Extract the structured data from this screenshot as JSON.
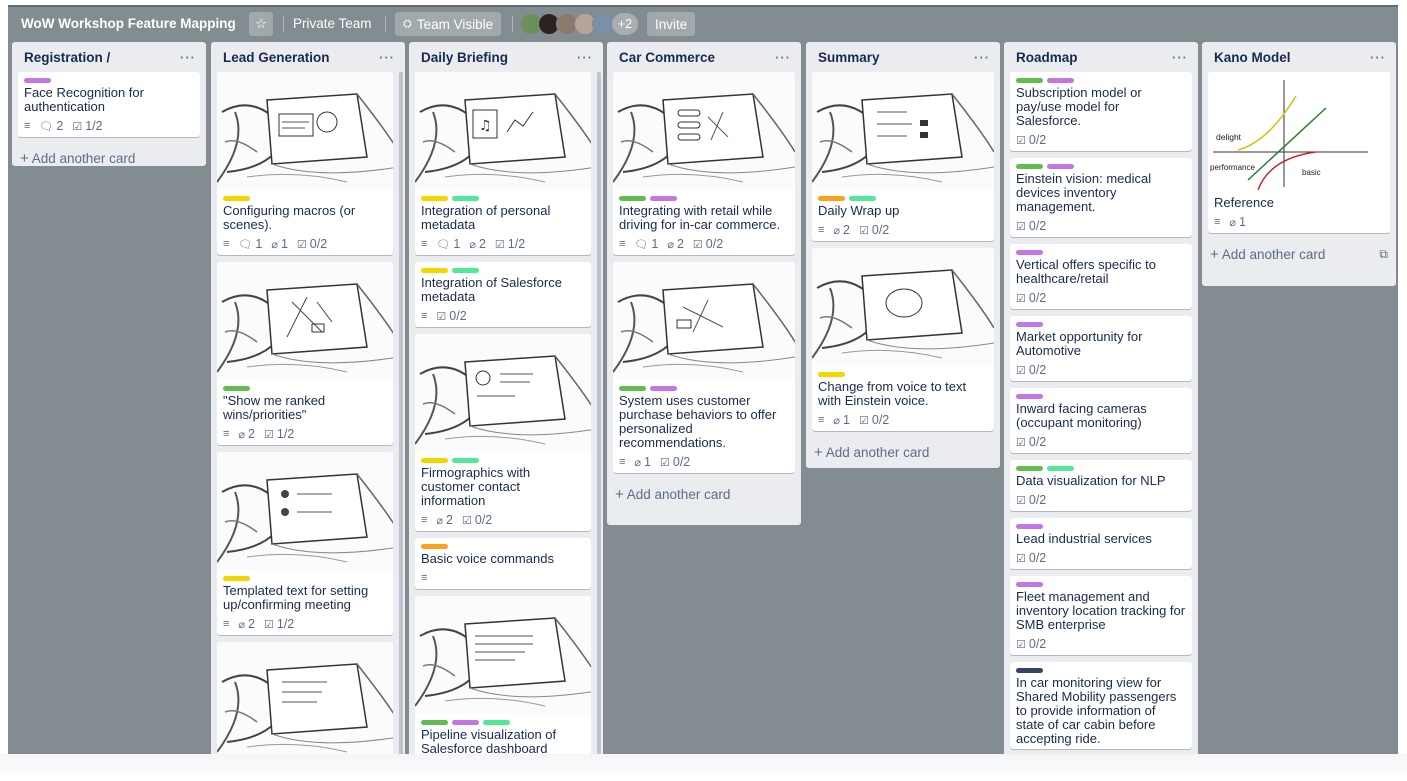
{
  "header": {
    "board_title": "WoW Workshop Feature Mapping",
    "star_icon": "star-icon",
    "team": "Private Team",
    "visibility": "Team Visible",
    "visibility_icon": "team-icon",
    "more_members": "+2",
    "invite": "Invite"
  },
  "colors": {
    "board_bg": "#838c91",
    "purple": "#c377e0",
    "green": "#61bd4f",
    "yellow": "#f2d600",
    "orange": "#ff9f1a",
    "teal": "#51e898",
    "navy": "#344563"
  },
  "add_card": "Add another card",
  "lists": [
    {
      "title": "Registration /",
      "cards": [
        {
          "labels": [
            "purple"
          ],
          "title": "Face Recognition for authentication",
          "badges": {
            "desc": true,
            "comments": "2",
            "checklist": "1/2"
          }
        }
      ]
    },
    {
      "title": "Lead Generation",
      "cards": [
        {
          "cover": true,
          "labels": [
            "yellow"
          ],
          "title": "Configuring macros (or scenes).",
          "badges": {
            "desc": true,
            "comments": "1",
            "attachments": "1",
            "checklist": "0/2"
          }
        },
        {
          "cover": true,
          "labels": [
            "green"
          ],
          "title": "\"Show me ranked wins/priorities\"",
          "badges": {
            "desc": true,
            "attachments": "2",
            "checklist": "1/2"
          }
        },
        {
          "cover": true,
          "labels": [
            "yellow"
          ],
          "title": "Templated text for setting up/confirming meeting",
          "badges": {
            "desc": true,
            "attachments": "2",
            "checklist": "1/2"
          }
        },
        {
          "cover": true,
          "labels": [],
          "title": ""
        }
      ]
    },
    {
      "title": "Daily Briefing",
      "cards": [
        {
          "cover": true,
          "labels": [
            "yellow",
            "teal"
          ],
          "title": "Integration of personal metadata",
          "badges": {
            "desc": true,
            "comments": "1",
            "attachments": "2",
            "checklist": "1/2"
          }
        },
        {
          "labels": [
            "yellow",
            "teal"
          ],
          "title": "Integration of Salesforce metadata",
          "badges": {
            "desc": true,
            "checklist": "0/2"
          }
        },
        {
          "cover": true,
          "labels": [
            "yellow",
            "teal"
          ],
          "title": "Firmographics with customer contact information",
          "badges": {
            "desc": true,
            "attachments": "2",
            "checklist": "0/2"
          }
        },
        {
          "labels": [
            "orange"
          ],
          "title": "Basic voice commands",
          "badges": {
            "desc": true
          }
        },
        {
          "cover": true,
          "labels": [
            "green",
            "purple",
            "teal"
          ],
          "title": "Pipeline visualization of Salesforce dashboard"
        }
      ]
    },
    {
      "title": "Car Commerce",
      "cards": [
        {
          "cover": true,
          "labels": [
            "green",
            "purple"
          ],
          "title": "Integrating with retail while driving for in-car commerce.",
          "badges": {
            "desc": true,
            "comments": "1",
            "attachments": "2",
            "checklist": "0/2"
          }
        },
        {
          "cover": true,
          "labels": [
            "green",
            "purple"
          ],
          "title": "System uses customer purchase behaviors to offer personalized recommendations.",
          "badges": {
            "desc": true,
            "attachments": "1",
            "checklist": "0/2"
          }
        }
      ]
    },
    {
      "title": "Summary",
      "cards": [
        {
          "cover": true,
          "labels": [
            "orange",
            "teal"
          ],
          "title": "Daily Wrap up",
          "badges": {
            "desc": true,
            "attachments": "2",
            "checklist": "0/2"
          }
        },
        {
          "cover": true,
          "labels": [
            "yellow"
          ],
          "title": "Change from voice to text with Einstein voice.",
          "badges": {
            "desc": true,
            "attachments": "1",
            "checklist": "0/2"
          }
        }
      ]
    },
    {
      "title": "Roadmap",
      "cards": [
        {
          "labels": [
            "green",
            "purple"
          ],
          "title": "Subscription model or pay/use model for Salesforce.",
          "badges": {
            "checklist": "0/2"
          }
        },
        {
          "labels": [
            "green",
            "purple"
          ],
          "title": "Einstein vision: medical devices inventory management.",
          "badges": {
            "checklist": "0/2"
          }
        },
        {
          "labels": [
            "purple"
          ],
          "title": "Vertical offers specific to healthcare/retail",
          "badges": {
            "checklist": "0/2"
          }
        },
        {
          "labels": [
            "purple"
          ],
          "title": "Market opportunity for Automotive",
          "badges": {
            "checklist": "0/2"
          }
        },
        {
          "labels": [
            "purple"
          ],
          "title": "Inward facing cameras (occupant monitoring)",
          "badges": {
            "checklist": "0/2"
          }
        },
        {
          "labels": [
            "green",
            "teal"
          ],
          "title": "Data visualization for NLP",
          "badges": {
            "checklist": "0/2"
          }
        },
        {
          "labels": [
            "purple"
          ],
          "title": "Lead industrial services",
          "badges": {
            "checklist": "0/2"
          }
        },
        {
          "labels": [
            "purple"
          ],
          "title": "Fleet management and inventory location tracking for SMB enterprise",
          "badges": {
            "checklist": "0/2"
          }
        },
        {
          "labels": [
            "navy"
          ],
          "title": "In car monitoring view for Shared Mobility passengers to provide information of state of car cabin before accepting ride."
        }
      ]
    },
    {
      "title": "Kano Model",
      "cards": [
        {
          "kano": true,
          "labels": [],
          "title": "Reference",
          "badges": {
            "desc": true,
            "attachments": "1"
          }
        }
      ],
      "kano_labels": {
        "delight": "delight",
        "performance": "performance",
        "basic": "basic"
      }
    }
  ]
}
